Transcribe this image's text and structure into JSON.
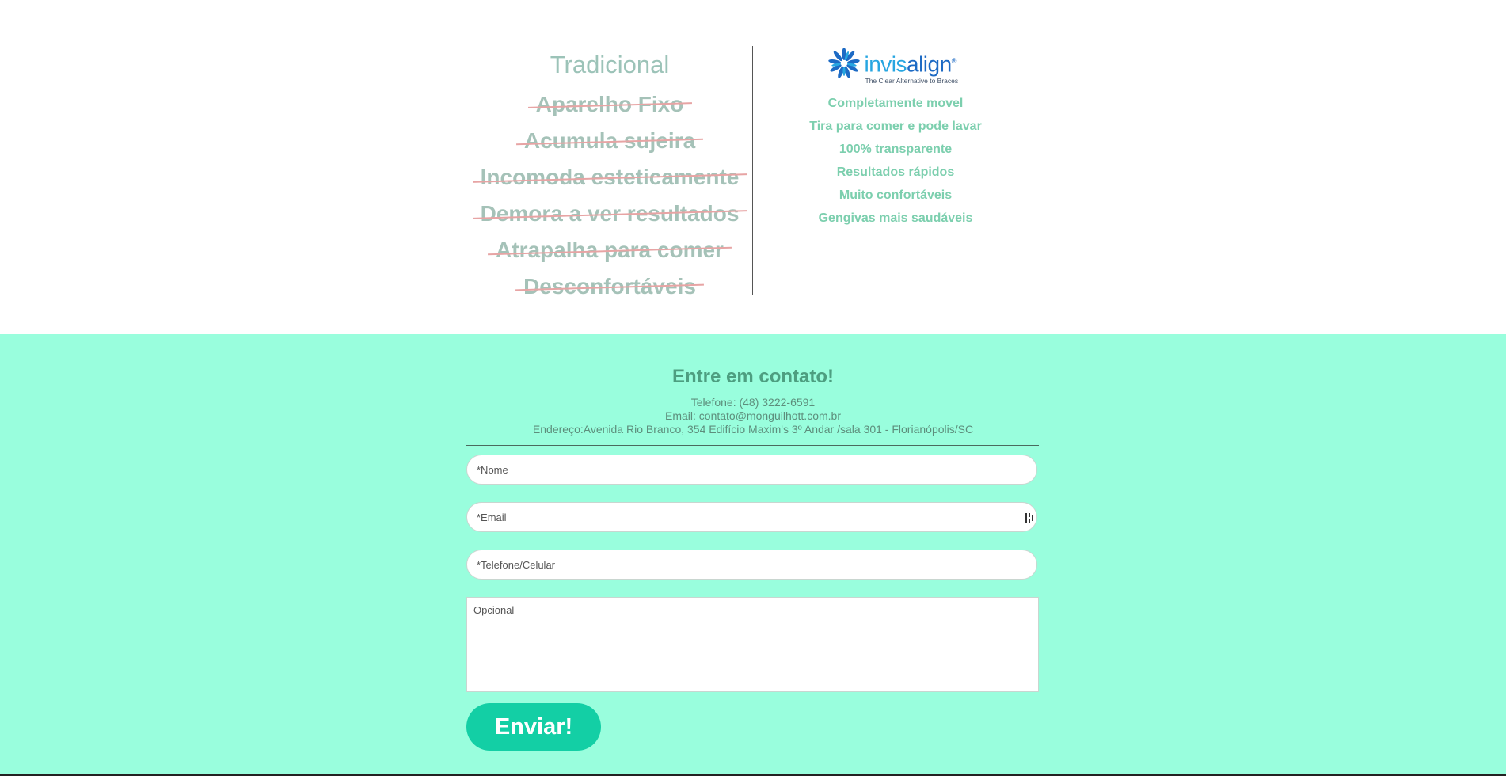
{
  "traditional": {
    "title": "Tradicional",
    "items": [
      "Aparelho Fixo",
      "Acumula sujeira",
      "Incomoda esteticamente",
      "Demora a ver resultados",
      "Atrapalha para comer",
      "Desconfortáveis"
    ]
  },
  "invisalign": {
    "logo_text_light": "invis",
    "logo_text_bold": "align",
    "logo_registered": "®",
    "logo_tagline": "The Clear Alternative to Braces",
    "items": [
      "Completamente movel",
      "Tira para comer e pode lavar",
      "100% transparente",
      "Resultados rápidos",
      "Muito confortáveis",
      "Gengivas mais saudáveis"
    ]
  },
  "contact": {
    "title": "Entre em contato!",
    "phone": "Telefone: (48) 3222-6591",
    "email": "Email: contato@monguilhott.com.br",
    "address": "Endereço:Avenida Rio Branco, 354 Edifício Maxim's 3º Andar /sala 301 - Florianópolis/SC"
  },
  "form": {
    "name_placeholder": "*Nome",
    "email_placeholder": "*Email",
    "phone_placeholder": "*Telefone/Celular",
    "message_placeholder": "Opcional",
    "submit_label": "Enviar!"
  },
  "colors": {
    "contact_bg": "#99fedd",
    "button_bg": "#13cfa5",
    "strike": "#e7a4a4",
    "logo_blue": "#1d6ac4"
  }
}
